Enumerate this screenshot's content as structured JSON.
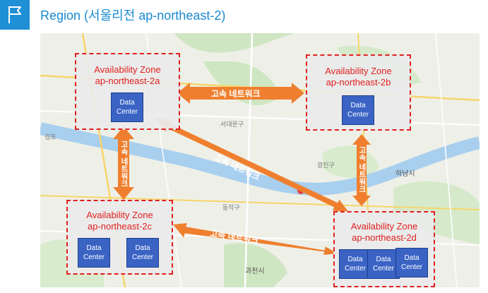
{
  "header": {
    "title": "Region (서울리전 ap-northeast-2)",
    "icon": "flag-icon",
    "accent": "#1f8fd6"
  },
  "zones": {
    "a": {
      "title": "Availability Zone",
      "subtitle": "ap-northeast-2a",
      "dc": [
        "Data",
        "Center"
      ]
    },
    "b": {
      "title": "Availability Zone",
      "subtitle": "ap-northeast-2b",
      "dc": [
        "Data",
        "Center"
      ]
    },
    "c": {
      "title": "Availability Zone",
      "subtitle": "ap-northeast-2c",
      "dc1": [
        "Data",
        "Center"
      ],
      "dc2": [
        "Data",
        "Center"
      ]
    },
    "d": {
      "title": "Availability Zone",
      "subtitle": "ap-northeast-2d",
      "dc1": [
        "Data",
        "Center"
      ],
      "dc2": [
        "Data",
        "Center"
      ],
      "dc3": [
        "Data",
        "Center"
      ]
    }
  },
  "links": {
    "ab": "고속 네트워크",
    "ac": "고속 네트워크",
    "bd": "고속 네트워크",
    "ad": "고속 네트워크",
    "cd": "고속 네트워크"
  },
  "map_labels": {
    "gwacheon": "과천시",
    "hanam": "하남시",
    "gimpo": "김포",
    "seodaemun": "서대문구",
    "dongjak": "동작구",
    "gwangjin": "광진구"
  },
  "colors": {
    "zone_border": "#e02020",
    "arrow": "#ef7f2e",
    "datacenter": "#3a63c4"
  }
}
